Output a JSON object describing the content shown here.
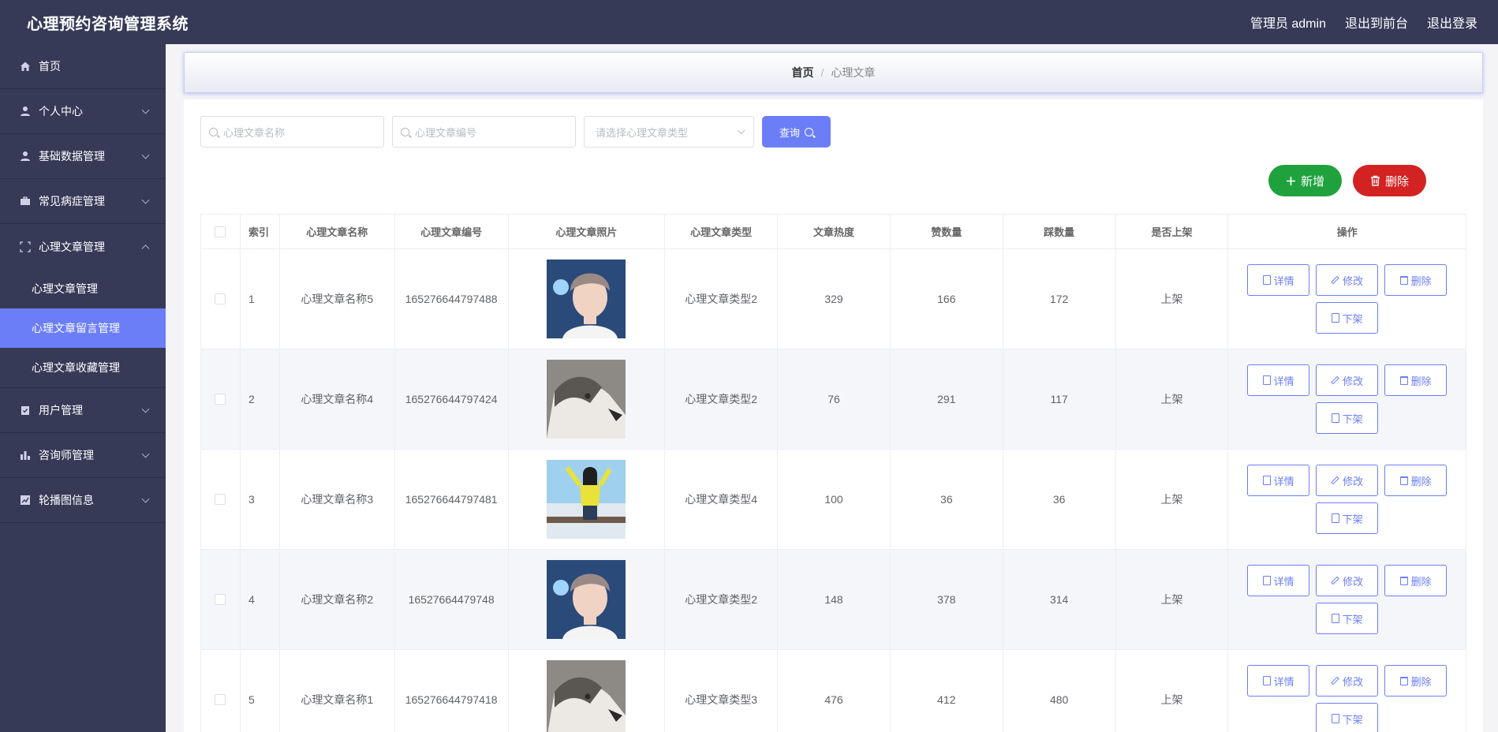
{
  "header": {
    "title": "心理预约咨询管理系统",
    "admin": "管理员 admin",
    "front": "退出到前台",
    "logout": "退出登录"
  },
  "sidebar": {
    "items": [
      {
        "label": "首页",
        "icon": "home-icon"
      },
      {
        "label": "个人中心",
        "icon": "user-icon"
      },
      {
        "label": "基础数据管理",
        "icon": "user-icon"
      },
      {
        "label": "常见病症管理",
        "icon": "briefcase-icon"
      },
      {
        "label": "心理文章管理",
        "icon": "fullscreen-icon"
      },
      {
        "label": "用户管理",
        "icon": "clipboard-icon"
      },
      {
        "label": "咨询师管理",
        "icon": "bar-chart-icon"
      },
      {
        "label": "轮播图信息",
        "icon": "chart-line-icon"
      }
    ],
    "sub_items": [
      "心理文章管理",
      "心理文章留言管理",
      "心理文章收藏管理"
    ]
  },
  "breadcrumb": {
    "home": "首页",
    "sep": "/",
    "current": "心理文章"
  },
  "search": {
    "name_placeholder": "心理文章名称",
    "code_placeholder": "心理文章编号",
    "type_placeholder": "请选择心理文章类型",
    "query": "查询"
  },
  "actions": {
    "add": "新增",
    "delete": "删除"
  },
  "table": {
    "headers": [
      "",
      "索引",
      "心理文章名称",
      "心理文章编号",
      "心理文章照片",
      "心理文章类型",
      "文章热度",
      "赞数量",
      "踩数量",
      "是否上架",
      "操作"
    ],
    "rows": [
      {
        "idx": "1",
        "name": "心理文章名称5",
        "code": "165276644797488",
        "type": "心理文章类型2",
        "hot": "329",
        "like": "166",
        "dislike": "172",
        "status": "上架",
        "photo": "boy"
      },
      {
        "idx": "2",
        "name": "心理文章名称4",
        "code": "165276644797424",
        "type": "心理文章类型2",
        "hot": "76",
        "like": "291",
        "dislike": "117",
        "status": "上架",
        "photo": "husky"
      },
      {
        "idx": "3",
        "name": "心理文章名称3",
        "code": "165276644797481",
        "type": "心理文章类型4",
        "hot": "100",
        "like": "36",
        "dislike": "36",
        "status": "上架",
        "photo": "girl"
      },
      {
        "idx": "4",
        "name": "心理文章名称2",
        "code": "16527664479748",
        "type": "心理文章类型2",
        "hot": "148",
        "like": "378",
        "dislike": "314",
        "status": "上架",
        "photo": "boy"
      },
      {
        "idx": "5",
        "name": "心理文章名称1",
        "code": "165276644797418",
        "type": "心理文章类型3",
        "hot": "476",
        "like": "412",
        "dislike": "480",
        "status": "上架",
        "photo": "husky"
      }
    ],
    "ops": {
      "detail": "详情",
      "edit": "修改",
      "remove": "删除",
      "offshelf": "下架"
    }
  },
  "colors": {
    "sidebar": "#363a57",
    "accent": "#6b7ef7",
    "green": "#1fa23e",
    "red": "#d32222"
  }
}
